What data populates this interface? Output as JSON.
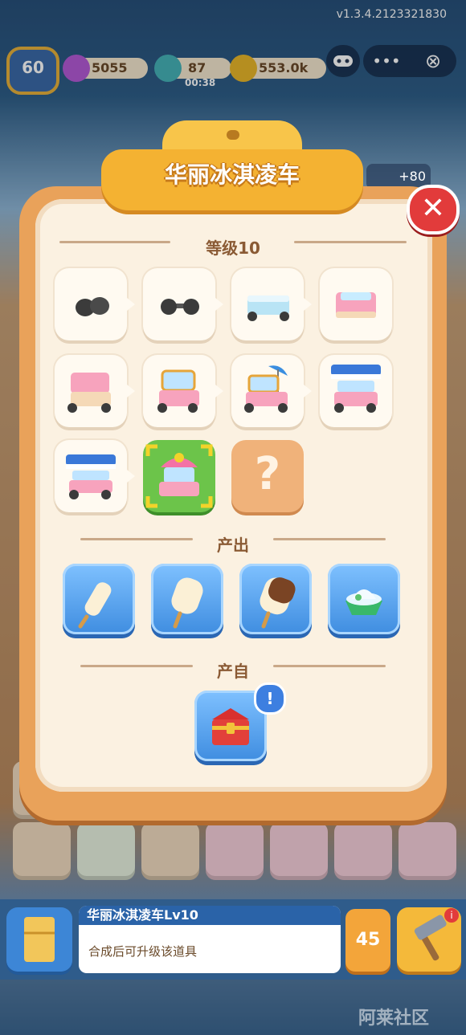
{
  "version": "v1.3.4.2123321830",
  "topbar": {
    "level": "60",
    "gems": "5055",
    "energy": "87",
    "energy_timer": "00:38",
    "coins": "553.0k",
    "side_bonus": "+80"
  },
  "capsule": {
    "more": "•••",
    "close": "⊗"
  },
  "dialog": {
    "title": "华丽冰淇凌车",
    "close": "✕",
    "level_label": "等级10",
    "evolution_count": 11,
    "unknown_mark": "?",
    "output_label": "产出",
    "source_label": "产自",
    "source_badge": "!"
  },
  "bottom": {
    "item_name": "华丽冰淇凌车Lv10",
    "item_desc": "合成后可升级该道具",
    "sell_value": "45"
  },
  "watermark": "阿莱社区",
  "colors": {
    "panel": "#e9a25a",
    "panel_inner": "#fbf1e1",
    "title_tag": "#f4b232",
    "close": "#e23b3b",
    "current_card": "#6cc44a",
    "blue_card": "#3f8de0"
  }
}
